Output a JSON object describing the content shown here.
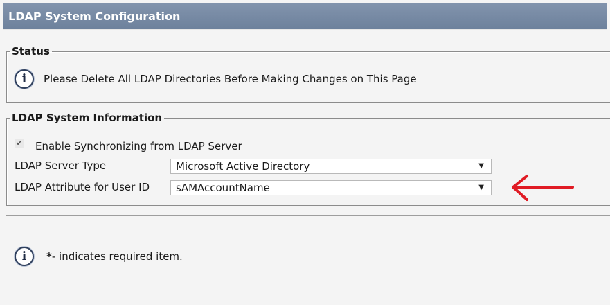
{
  "title": "LDAP System Configuration",
  "status": {
    "legend": "Status",
    "icon": "info-icon",
    "message": "Please Delete All LDAP Directories Before Making Changes on This Page"
  },
  "system_info": {
    "legend": "LDAP System Information",
    "sync_checkbox": {
      "label": "Enable Synchronizing from LDAP Server",
      "checked": true
    },
    "server_type": {
      "label": "LDAP Server Type",
      "value": "Microsoft Active Directory"
    },
    "user_id_attr": {
      "label": "LDAP Attribute for User ID",
      "value": "sAMAccountName"
    }
  },
  "footer": {
    "icon": "info-icon",
    "required_marker": "*",
    "required_note": "- indicates required item."
  },
  "annotation": {
    "arrow_color": "#e01b24"
  }
}
